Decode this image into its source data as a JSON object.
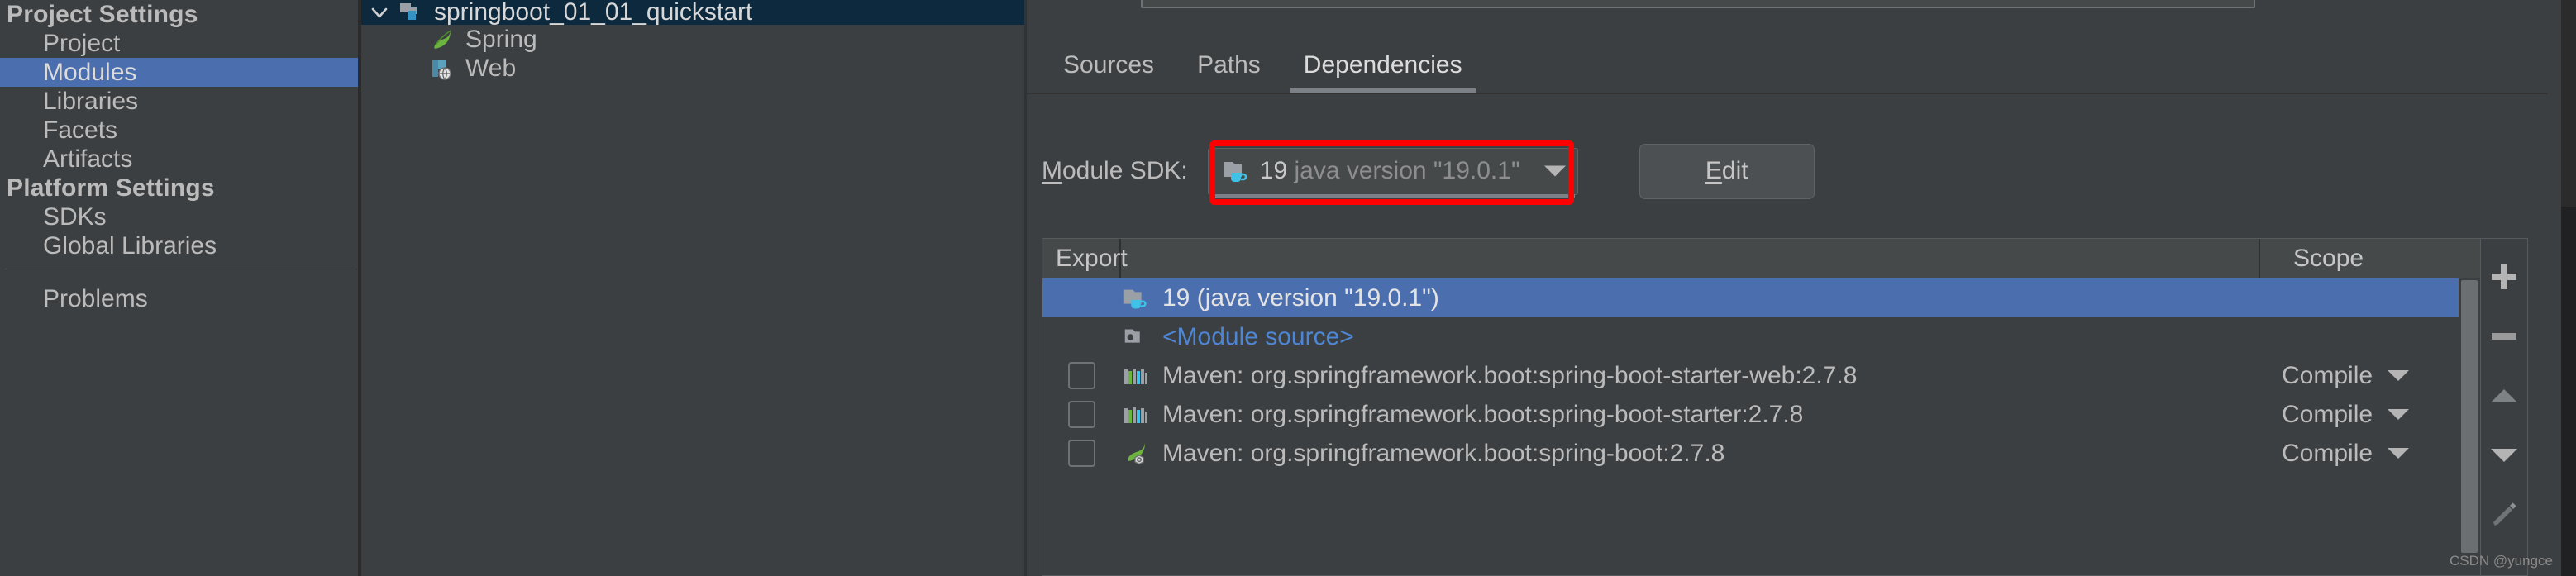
{
  "sidebar": {
    "groups": [
      {
        "title": "Project Settings",
        "items": [
          {
            "label": "Project",
            "selected": false
          },
          {
            "label": "Modules",
            "selected": true
          },
          {
            "label": "Libraries",
            "selected": false
          },
          {
            "label": "Facets",
            "selected": false
          },
          {
            "label": "Artifacts",
            "selected": false
          }
        ]
      },
      {
        "title": "Platform Settings",
        "items": [
          {
            "label": "SDKs",
            "selected": false
          },
          {
            "label": "Global Libraries",
            "selected": false
          }
        ]
      }
    ],
    "footer_item": "Problems"
  },
  "module_tree": {
    "root": {
      "label": "springboot_01_01_quickstart",
      "icon": "module-icon",
      "expanded": true,
      "selected": true
    },
    "children": [
      {
        "label": "Spring",
        "icon": "spring-leaf-icon"
      },
      {
        "label": "Web",
        "icon": "web-facet-icon"
      }
    ]
  },
  "tabs": [
    {
      "label": "Sources",
      "active": false
    },
    {
      "label": "Paths",
      "active": false
    },
    {
      "label": "Dependencies",
      "active": true
    }
  ],
  "module_sdk": {
    "label": "Module SDK:",
    "label_mnemonic": "M",
    "icon": "jdk-folder-icon",
    "value_name": "19",
    "value_version": "java version \"19.0.1\"",
    "dropdown_icon": "chevron-down-icon",
    "highlight_color": "#ff0000",
    "edit_button": {
      "label": "Edit",
      "mnemonic": "E"
    }
  },
  "dependencies_table": {
    "columns": {
      "export": "Export",
      "name": "",
      "scope": "Scope"
    },
    "rows": [
      {
        "checkbox": null,
        "icon": "jdk-folder-icon",
        "name": "19 (java version \"19.0.1\")",
        "scope": "",
        "selected": true,
        "link": false
      },
      {
        "checkbox": null,
        "icon": "module-source-icon",
        "name": "<Module source>",
        "scope": "",
        "selected": false,
        "link": true
      },
      {
        "checkbox": false,
        "icon": "maven-library-icon",
        "name": "Maven: org.springframework.boot:spring-boot-starter-web:2.7.8",
        "scope": "Compile",
        "selected": false,
        "link": false
      },
      {
        "checkbox": false,
        "icon": "maven-library-icon",
        "name": "Maven: org.springframework.boot:spring-boot-starter:2.7.8",
        "scope": "Compile",
        "selected": false,
        "link": false
      },
      {
        "checkbox": false,
        "icon": "spring-boot-icon",
        "name": "Maven: org.springframework.boot:spring-boot:2.7.8",
        "scope": "Compile",
        "selected": false,
        "link": false
      }
    ],
    "toolbar": [
      {
        "name": "add-dependency-button",
        "icon": "plus-icon"
      },
      {
        "name": "remove-dependency-button",
        "icon": "minus-icon"
      },
      {
        "name": "move-up-button",
        "icon": "arrow-up-icon"
      },
      {
        "name": "move-down-button",
        "icon": "arrow-down-icon"
      },
      {
        "name": "edit-dependency-button",
        "icon": "pencil-icon"
      }
    ]
  },
  "watermark": "CSDN @yungce",
  "colors": {
    "selection_blue": "#4b6eaf",
    "panel_bg": "#3c3f41",
    "tree_selected_bg": "#0d293e",
    "highlight_red": "#ff0000",
    "link_blue": "#4e86d6"
  }
}
